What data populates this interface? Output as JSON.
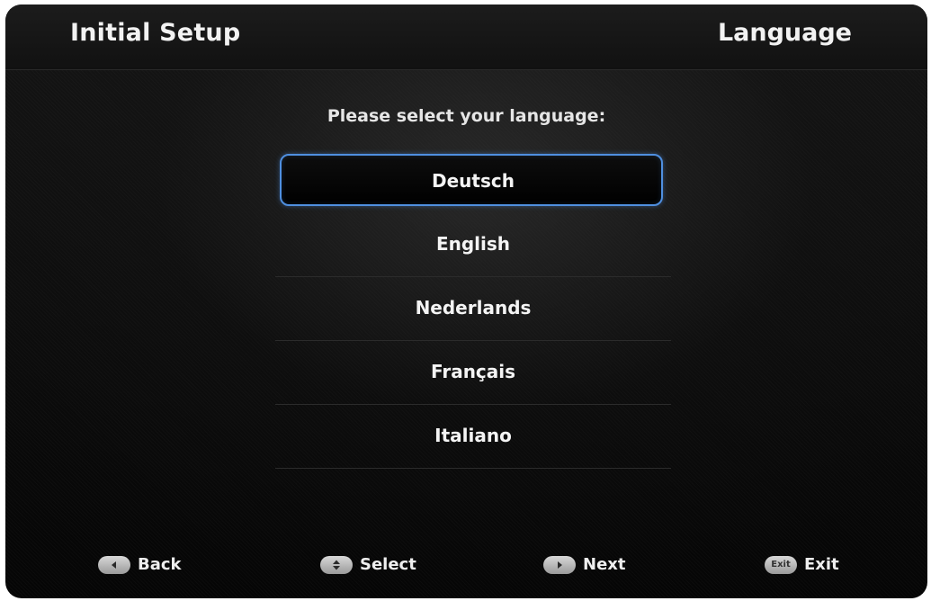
{
  "header": {
    "title": "Initial Setup",
    "section": "Language"
  },
  "prompt": "Please select your language:",
  "languages": [
    {
      "label": "Deutsch",
      "selected": true
    },
    {
      "label": "English",
      "selected": false
    },
    {
      "label": "Nederlands",
      "selected": false
    },
    {
      "label": "Français",
      "selected": false
    },
    {
      "label": "Italiano",
      "selected": false
    }
  ],
  "footer": {
    "back_label": "Back",
    "back_icon": "left-arrow-icon",
    "select_label": "Select",
    "select_icon": "up-down-arrow-icon",
    "next_label": "Next",
    "next_icon": "right-arrow-icon",
    "exit_label": "Exit",
    "exit_key": "Exit"
  },
  "colors": {
    "selection_border": "#4f8fe0",
    "background": "#0b0b0b",
    "text": "#f4f4f4"
  }
}
